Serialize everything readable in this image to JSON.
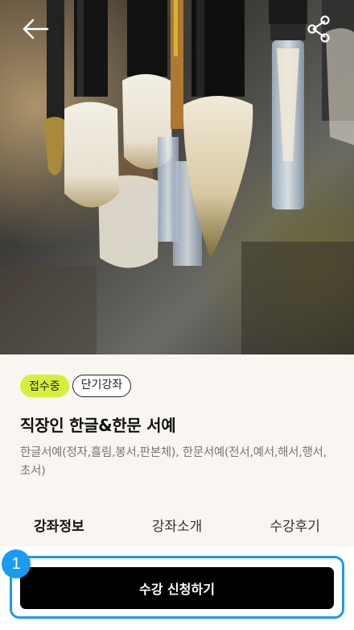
{
  "hero": {
    "image_name": "calligraphy-brushes-photo",
    "back_icon": "arrow-left-icon",
    "share_icon": "share-icon"
  },
  "course": {
    "badges": [
      "접수중",
      "단기강좌"
    ],
    "title": "직장인 한글&한문 서예",
    "description": "한글서예(정자,흘림,봉서,판본체), 한문서예(전서,예서,해서,행서,초서)"
  },
  "tabs": [
    {
      "label": "강좌정보",
      "active": true
    },
    {
      "label": "강좌소개",
      "active": false
    },
    {
      "label": "수강후기",
      "active": false
    }
  ],
  "cta": {
    "label": "수강 신청하기",
    "marker": "1"
  },
  "colors": {
    "accent": "#1a9bef",
    "status_badge": "#d8ee3d",
    "button": "#000000"
  }
}
